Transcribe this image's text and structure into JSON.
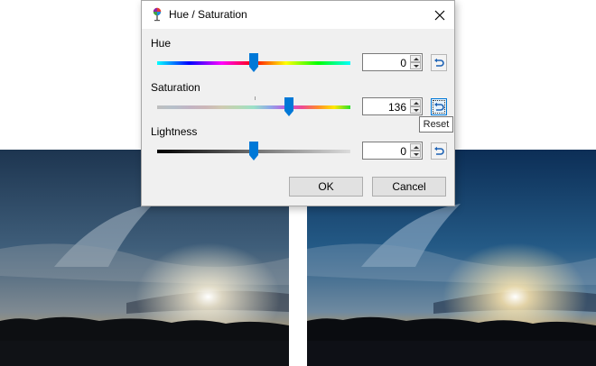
{
  "dialog": {
    "title": "Hue / Saturation",
    "icon": "color-palette-icon"
  },
  "hue": {
    "label": "Hue",
    "value": "0",
    "slider_fraction": 0.5
  },
  "saturation": {
    "label": "Saturation",
    "value": "136",
    "slider_fraction": 0.68
  },
  "lightness": {
    "label": "Lightness",
    "value": "0",
    "slider_fraction": 0.5
  },
  "tooltip": {
    "text": "Reset"
  },
  "buttons": {
    "ok": "OK",
    "cancel": "Cancel"
  },
  "colors": {
    "accent": "#0078d7",
    "dialog_bg": "#f0f0f0"
  }
}
